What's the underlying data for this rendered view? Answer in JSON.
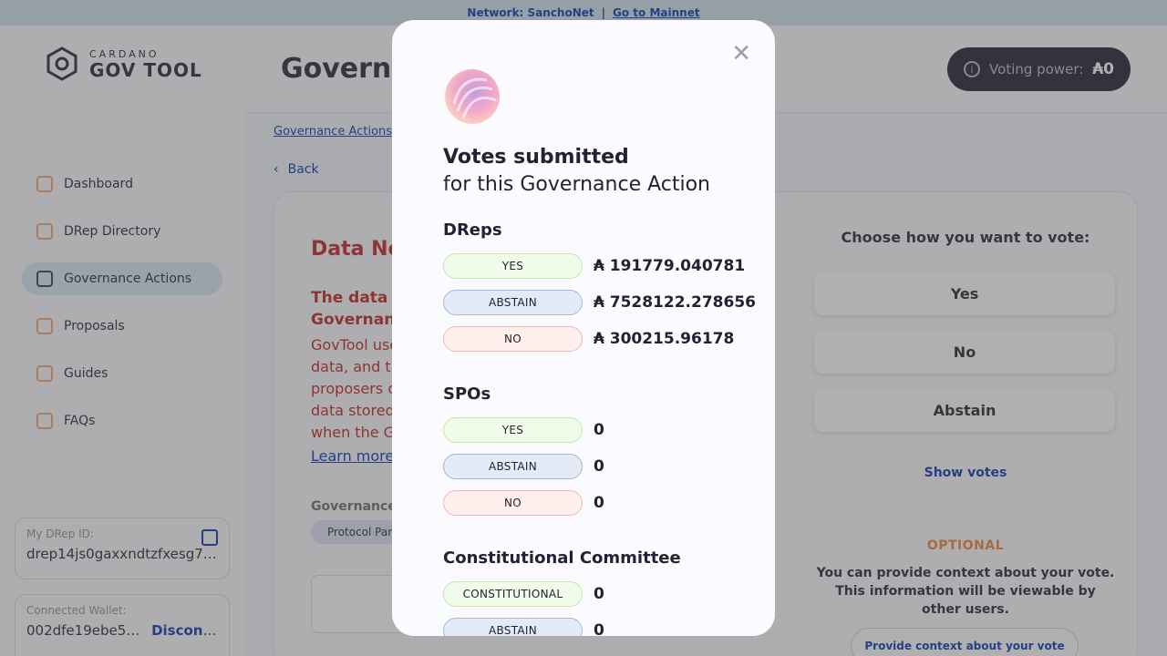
{
  "banner": {
    "network": "Network: SanchoNet",
    "separator": "|",
    "mainnet_link": "Go to Mainnet"
  },
  "sidebar": {
    "logo_top": "CARDANO",
    "logo_bottom": "GOV TOOL",
    "items": [
      {
        "label": "Dashboard",
        "icon": "dashboard-icon"
      },
      {
        "label": "DRep Directory",
        "icon": "drep-directory-icon"
      },
      {
        "label": "Governance Actions",
        "icon": "governance-actions-icon",
        "active": true
      },
      {
        "label": "Proposals",
        "icon": "proposals-icon"
      },
      {
        "label": "Guides",
        "icon": "guides-icon"
      },
      {
        "label": "FAQs",
        "icon": "faqs-icon"
      }
    ],
    "drep_id_label": "My DRep ID:",
    "drep_id_value": "drep14js0gaxxndtzfxesg7pf…",
    "wallet_label": "Connected Wallet:",
    "wallet_value": "002dfe19ebe5…",
    "disconnect_label": "Disconnect"
  },
  "header": {
    "title": "Governa",
    "voting_power_label": "Voting power:",
    "voting_power_value": "₳0"
  },
  "breadcrumb": "Governance Actions",
  "back_label": "Back",
  "content": {
    "title": "Data No",
    "subtitle_line1": "The data",
    "subtitle_line2": "Governan",
    "text_lines": [
      "GovTool use",
      "data, and th",
      "proposers c",
      "data stored",
      "when the G"
    ],
    "learn_more": "Learn more",
    "gov_type_label": "Governance",
    "gov_type_chip": "Protocol Par"
  },
  "vote_panel": {
    "heading": "Choose how you want to vote:",
    "options": [
      "Yes",
      "No",
      "Abstain"
    ],
    "show_votes": "Show votes",
    "optional_label": "OPTIONAL",
    "optional_text": "You can provide context about your vote. This information will be viewable by other users.",
    "context_button": "Provide context about your vote"
  },
  "modal": {
    "title": "Votes submitted",
    "subtitle": "for this Governance Action",
    "close_icon": "close-icon",
    "sections": [
      {
        "title": "DReps",
        "rows": [
          {
            "label": "YES",
            "kind": "yes",
            "value": "₳ 191779.040781"
          },
          {
            "label": "ABSTAIN",
            "kind": "abstain",
            "value": "₳ 7528122.278656"
          },
          {
            "label": "NO",
            "kind": "no",
            "value": "₳ 300215.96178"
          }
        ]
      },
      {
        "title": "SPOs",
        "rows": [
          {
            "label": "YES",
            "kind": "yes",
            "value": "0"
          },
          {
            "label": "ABSTAIN",
            "kind": "abstain",
            "value": "0"
          },
          {
            "label": "NO",
            "kind": "no",
            "value": "0"
          }
        ]
      },
      {
        "title": "Constitutional Committee",
        "rows": [
          {
            "label": "CONSTITUTIONAL",
            "kind": "yes",
            "value": "0"
          },
          {
            "label": "ABSTAIN",
            "kind": "abstain",
            "value": "0"
          }
        ]
      }
    ]
  }
}
